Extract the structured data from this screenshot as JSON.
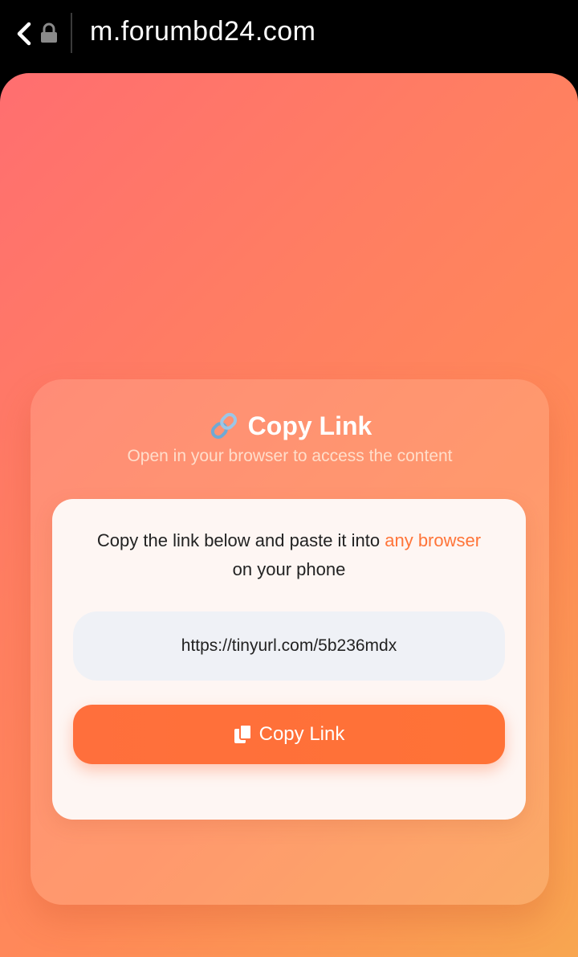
{
  "browser": {
    "url": "m.forumbd24.com"
  },
  "card": {
    "title": "Copy Link",
    "subtitle": "Open in your browser to access the content",
    "instruction_before": "Copy the link below and paste it into ",
    "instruction_accent": "any browser",
    "instruction_after": "on your phone",
    "link": "https://tinyurl.com/5b236mdx",
    "button_label": "Copy Link"
  },
  "icons": {
    "back": "chevron-left-icon",
    "lock": "lock-icon",
    "link": "link-icon",
    "copy": "copy-icon"
  },
  "colors": {
    "accent": "#ff7438",
    "button": "#ff6f3c"
  }
}
